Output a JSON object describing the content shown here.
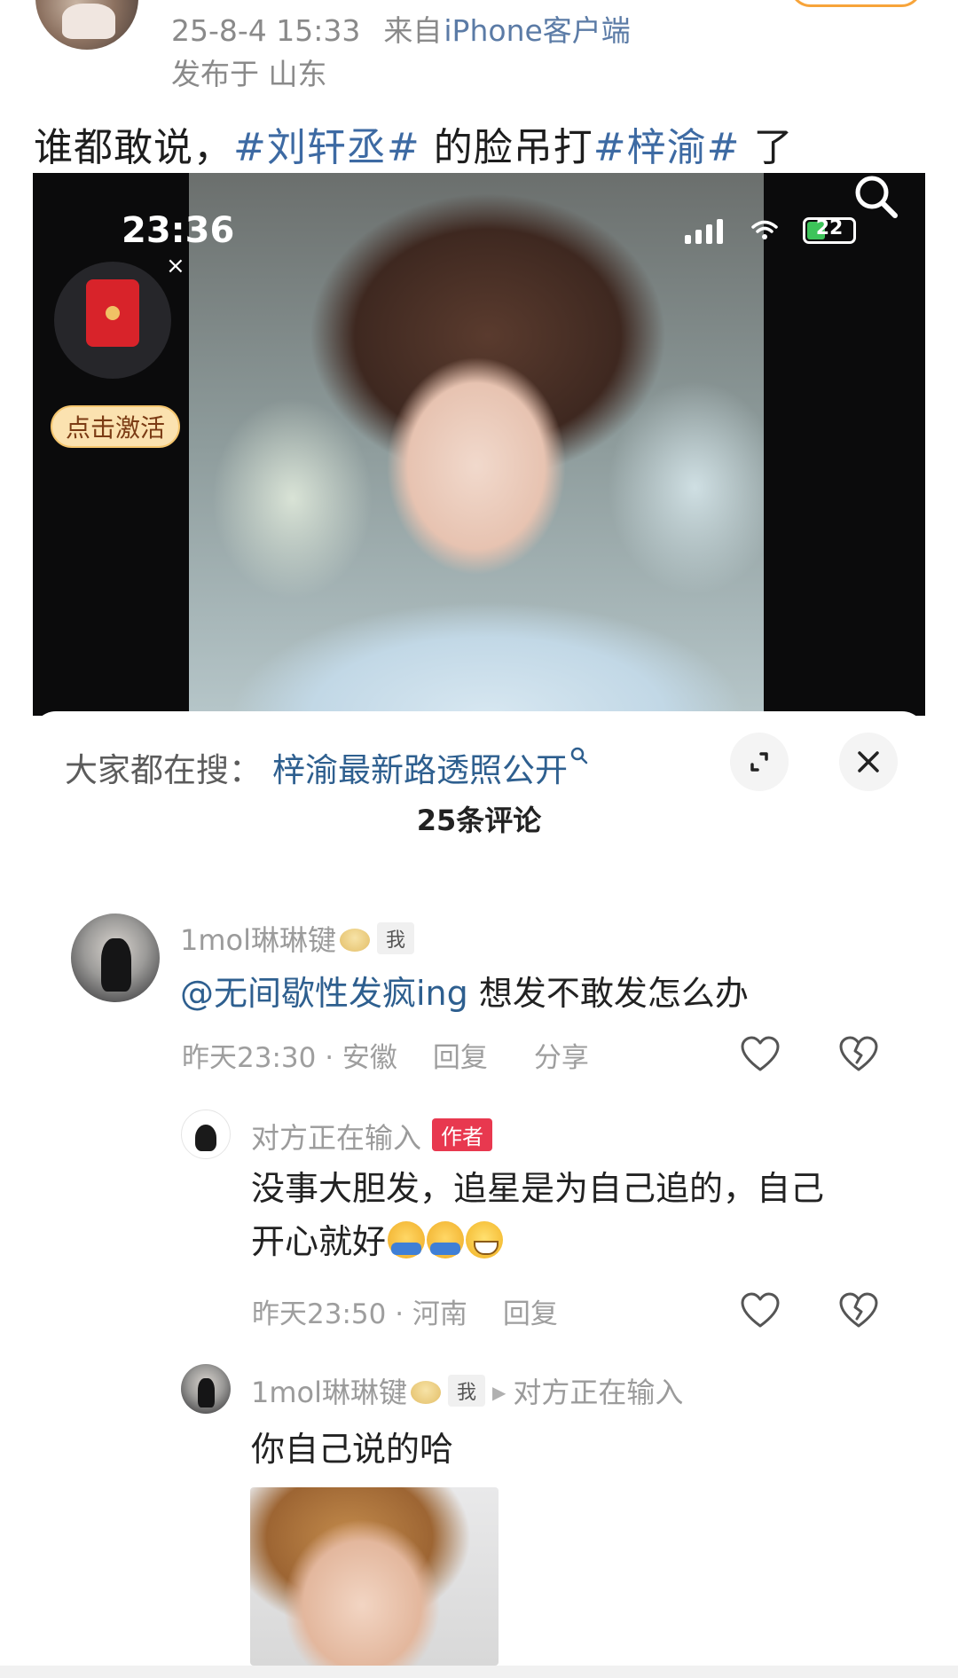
{
  "post": {
    "timestamp": "25-8-4 15:33",
    "source_prefix": "来自",
    "source_client": "iPhone客户端",
    "location": "发布于 山东",
    "text_parts": [
      "谁都敢说，",
      "#刘轩丞#",
      " 的脸吊打",
      "#梓渝#",
      " 了"
    ]
  },
  "video": {
    "status_time": "23:36",
    "battery": "22",
    "redpacket_close": "×",
    "redpacket_label": "点击激活"
  },
  "sheet": {
    "search_label": "大家都在搜：",
    "search_query": "梓渝最新路透照公开",
    "comment_count": "25条评论"
  },
  "comments": [
    {
      "user": "1mol琳琳键",
      "tag": "我",
      "mention": "@无间歇性发疯ing",
      "text": " 想发不敢发怎么办",
      "time_loc": "昨天23:30 · 安徽",
      "reply": "回复",
      "share": "分享"
    },
    {
      "user": "对方正在输入",
      "tag": "作者",
      "text_line1": "没事大胆发，追星是为自己追的，自己",
      "text_line2": "开心就好",
      "time_loc": "昨天23:50 · 河南",
      "reply": "回复"
    },
    {
      "user": "1mol琳琳键",
      "tag": "我",
      "reply_to": "对方正在输入",
      "text": "你自己说的哈"
    }
  ],
  "colors": {
    "link_blue": "#2e5f8f",
    "hashtag_blue": "#3d6aa3",
    "meta_gray": "#8a8a8a",
    "author_red": "#e8384f"
  }
}
